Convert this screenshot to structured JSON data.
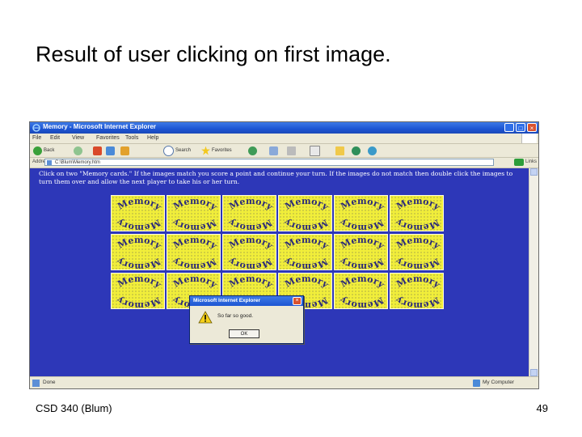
{
  "slide": {
    "title": "Result of user clicking on first image.",
    "footer_left": "CSD 340 (Blum)",
    "page_number": "49"
  },
  "window": {
    "title": "Memory - Microsoft Internet Explorer",
    "minimize_label": "_",
    "maximize_label": "□",
    "close_label": "×"
  },
  "menubar": {
    "items": [
      "File",
      "Edit",
      "View",
      "Favorites",
      "Tools",
      "Help"
    ]
  },
  "toolbar": {
    "back_label": "Back",
    "search_label": "Search",
    "favorites_label": "Favorites"
  },
  "addressbar": {
    "label": "Address",
    "url": "C:\\Blum\\Memory.htm",
    "links_label": "Links"
  },
  "page": {
    "instructions": "Click on two \"Memory cards.\" If the images match you score a point and continue your turn. If the images do not match then double click the images to turn them over and allow the next player to take his or her turn.",
    "card_word_top": "Memory",
    "card_word_bottom": "Memory",
    "grid_rows": 3,
    "grid_cols": 6
  },
  "dialog": {
    "title": "Microsoft Internet Explorer",
    "message": "So far so good.",
    "ok_label": "OK",
    "close_label": "×"
  },
  "statusbar": {
    "status": "Done",
    "zone": "My Computer"
  },
  "colors": {
    "page_background": "#2d37b8",
    "card": "#f1ee3a",
    "titlebar": "#1d55d3"
  }
}
